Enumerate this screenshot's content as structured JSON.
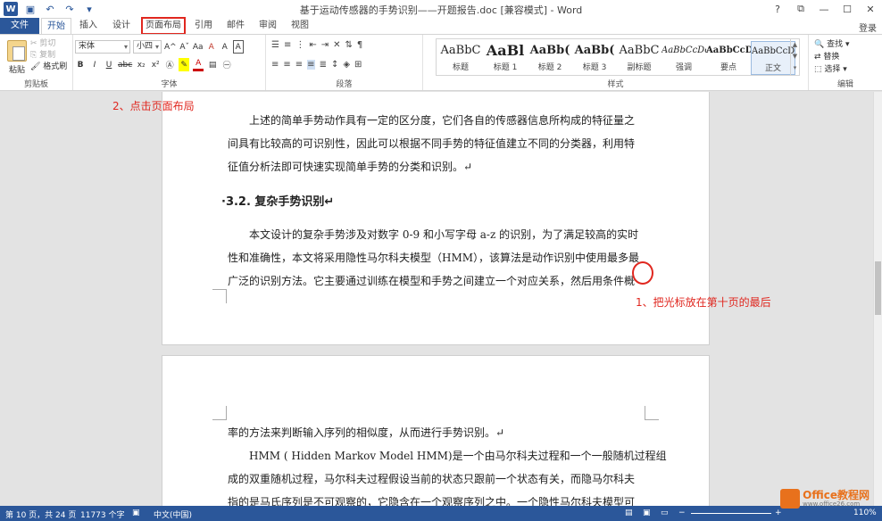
{
  "window": {
    "title": "基于运动传感器的手势识别——开题报告.doc [兼容模式] - Word",
    "controls": [
      "?",
      "⧉",
      "—",
      "☐",
      "✕"
    ]
  },
  "tabs": {
    "file": "文件",
    "items": [
      "开始",
      "插入",
      "设计",
      "页面布局",
      "引用",
      "邮件",
      "审阅",
      "视图"
    ],
    "login": "登录"
  },
  "ribbon": {
    "clipboard": {
      "paste": "粘贴",
      "cut": "剪切",
      "copy": "复制",
      "format_painter": "格式刷",
      "label": "剪贴板"
    },
    "font": {
      "name": "宋体",
      "size": "小四",
      "label": "字体",
      "b": "B",
      "i": "I",
      "u": "U",
      "strike": "abc",
      "sub": "x₂",
      "sup": "x²",
      "grow": "A^",
      "shrink": "Aˇ",
      "case": "Aa",
      "clear": "A",
      "pinyin": "A",
      "border": "A"
    },
    "paragraph": {
      "label": "段落"
    },
    "styles": {
      "label": "样式",
      "items": [
        {
          "preview": "AaBbC",
          "name": "标题"
        },
        {
          "preview": "AaBl",
          "name": "标题 1"
        },
        {
          "preview": "AaBb(",
          "name": "标题 2"
        },
        {
          "preview": "AaBb(",
          "name": "标题 3"
        },
        {
          "preview": "AaBbC",
          "name": "副标题"
        },
        {
          "preview": "AaBbCcDc",
          "name": "强调"
        },
        {
          "preview": "AaBbCcD",
          "name": "要点"
        },
        {
          "preview": "AaBbCcDc",
          "name": "正文"
        }
      ]
    },
    "editing": {
      "find": "查找",
      "replace": "替换",
      "select": "选择",
      "label": "编辑"
    }
  },
  "document": {
    "page1_lines": [
      "上述的简单手势动作具有一定的区分度，它们各自的传感器信息所构成的特征量之",
      "间具有比较高的可识别性，因此可以根据不同手势的特征值建立不同的分类器，利用特",
      "征值分析法即可快速实现简单手势的分类和识别。↵"
    ],
    "heading": "·3.2.  复杂手势识别↵",
    "page1_para2": [
      "本文设计的复杂手势涉及对数字 0-9 和小写字母 a-z 的识别，为了满足较高的实时",
      "性和准确性，本文将采用隐性马尔科夫模型（HMM），该算法是动作识别中使用最多最",
      "广泛的识别方法。它主要通过训练在模型和手势之间建立一个对应关系，然后用条件概"
    ],
    "page2_lines": [
      "率的方法来判断输入序列的相似度，从而进行手势识别。↵",
      "HMM ( Hidden Markov Model HMM)是一个由马尔科夫过程和一个一般随机过程组",
      "成的双重随机过程，马尔科夫过程假设当前的状态只跟前一个状态有关，而隐马尔科夫",
      "指的是马氏序列是不可观察的，它隐含在一个观察序列之中。一个隐性马尔科夫模型可"
    ]
  },
  "annotations": {
    "step2": "2、点击页面布局",
    "step1": "1、把光标放在第十页的最后"
  },
  "status": {
    "page": "第 10 页，共 24 页",
    "words": "11773 个字",
    "lang": "中文(中国)",
    "zoom": "110%"
  },
  "watermark": {
    "brand": "Office教程网",
    "url": "www.office26.com"
  },
  "colors": {
    "accent": "#2b579a",
    "annotation": "#e0271f"
  }
}
